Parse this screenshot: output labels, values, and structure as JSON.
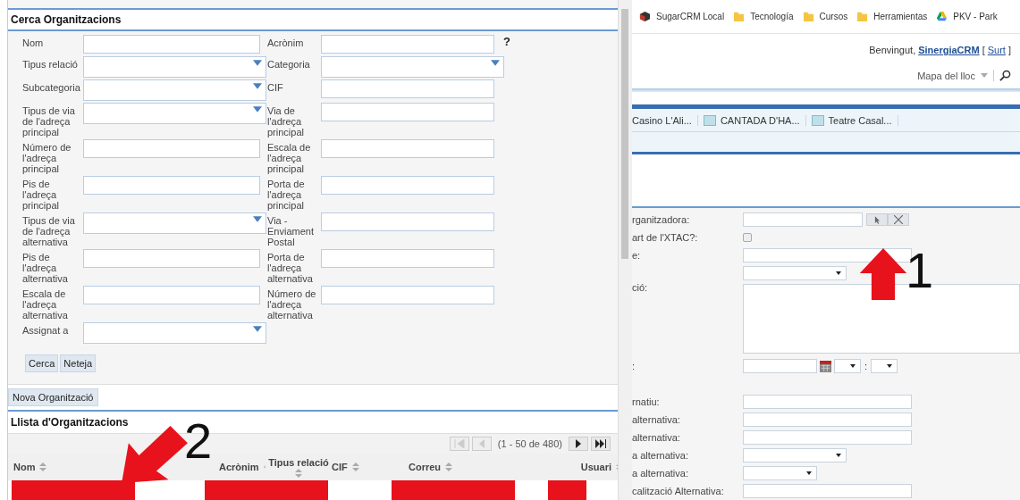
{
  "search_panel": {
    "title": "Cerca Organitzacions",
    "help": "?",
    "rows": [
      [
        {
          "label": "Nom",
          "kind": "text"
        },
        {
          "label": "Acrònim",
          "kind": "text"
        }
      ],
      [
        {
          "label": "Tipus relació",
          "kind": "select"
        },
        {
          "label": "Categoria",
          "kind": "select"
        }
      ],
      [
        {
          "label": "Subcategoria",
          "kind": "select"
        },
        {
          "label": "CIF",
          "kind": "text"
        }
      ],
      [
        {
          "label": "Tipus de via de l'adreça principal",
          "kind": "select"
        },
        {
          "label": "Via de l'adreça principal",
          "kind": "text"
        }
      ],
      [
        {
          "label": "Número de l'adreça principal",
          "kind": "text"
        },
        {
          "label": "Escala de l'adreça principal",
          "kind": "text"
        }
      ],
      [
        {
          "label": "Pis de l'adreça principal",
          "kind": "text"
        },
        {
          "label": "Porta de l'adreça principal",
          "kind": "text"
        }
      ],
      [
        {
          "label": "Tipus de via de l'adreça alternativa",
          "kind": "select"
        },
        {
          "label": "Via - Enviament Postal",
          "kind": "text"
        }
      ],
      [
        {
          "label": "Pis de l'adreça alternativa",
          "kind": "text"
        },
        {
          "label": "Porta de l'adreça alternativa",
          "kind": "text"
        }
      ],
      [
        {
          "label": "Escala de l'adreça alternativa",
          "kind": "text"
        },
        {
          "label": "Número de l'adreça alternativa",
          "kind": "text"
        }
      ],
      [
        {
          "label": "Assignat a",
          "kind": "select"
        }
      ]
    ],
    "buttons": [
      "Cerca",
      "Neteja"
    ]
  },
  "new_button": "Nova Organització",
  "list": {
    "title": "Llista d'Organitzacions",
    "pagination": "(1 - 50 de 480)",
    "pager_buttons": [
      {
        "kind": "first",
        "disabled": true
      },
      {
        "kind": "prev",
        "disabled": true
      },
      {
        "kind": "next",
        "disabled": false
      },
      {
        "kind": "last",
        "disabled": false
      }
    ],
    "columns": [
      {
        "label": "Nom"
      },
      {
        "label": "Acrònim"
      },
      {
        "label": "Tipus relació"
      },
      {
        "label": "CIF"
      },
      {
        "label": "Correu"
      },
      {
        "label": "Usuari"
      }
    ],
    "rows": [
      {
        "cells": [
          {
            "redacted": true
          },
          {
            "redacted": false
          },
          {
            "redacted": true
          },
          {
            "redacted": false
          },
          {
            "redacted": true
          },
          {
            "redacted": false
          },
          {
            "redacted": true
          }
        ]
      }
    ]
  },
  "annotations": [
    {
      "kind": "arrow_up",
      "label": "1"
    },
    {
      "kind": "arrow_down_left",
      "label": "2"
    }
  ],
  "bookmarks": [
    {
      "label": "SugarCRM Local",
      "kind": "app"
    },
    {
      "label": "Tecnología",
      "kind": "folder"
    },
    {
      "label": "Cursos",
      "kind": "folder"
    },
    {
      "label": "Herramientas",
      "kind": "folder"
    },
    {
      "label": "PKV - Park",
      "kind": "drive"
    }
  ],
  "header": {
    "greeting": "Benvingut,",
    "user": "SinergiaCRM",
    "logout_open": "[",
    "logout": "Surt",
    "logout_close": "]",
    "sitemap": "Mapa del lloc"
  },
  "tabs": [
    {
      "label": "Casino L'Ali...",
      "icon": false
    },
    {
      "label": "CANTADA D'HA...",
      "icon": true
    },
    {
      "label": "Teatre Casal...",
      "icon": true
    }
  ],
  "form": {
    "rows": [
      {
        "label": "rganitzadora:",
        "kind": "relate"
      },
      {
        "label": "art de l'XTAC?:",
        "kind": "checkbox",
        "checked": false
      },
      {
        "label": "e:",
        "kind": "text"
      },
      {
        "kind": "select"
      },
      {
        "label": "ció:",
        "kind": "textarea"
      },
      {
        "label": ":",
        "kind": "datetime",
        "separator": ":"
      },
      {
        "kind": "spacer"
      },
      {
        "label": "rnatiu:",
        "kind": "text"
      },
      {
        "label": "alternativa:",
        "kind": "text"
      },
      {
        "label": "alternativa:",
        "kind": "text"
      },
      {
        "label": "a alternativa:",
        "kind": "select"
      },
      {
        "label": "a alternativa:",
        "kind": "select_small"
      },
      {
        "label": "calització Alternativa:",
        "kind": "text"
      }
    ]
  }
}
